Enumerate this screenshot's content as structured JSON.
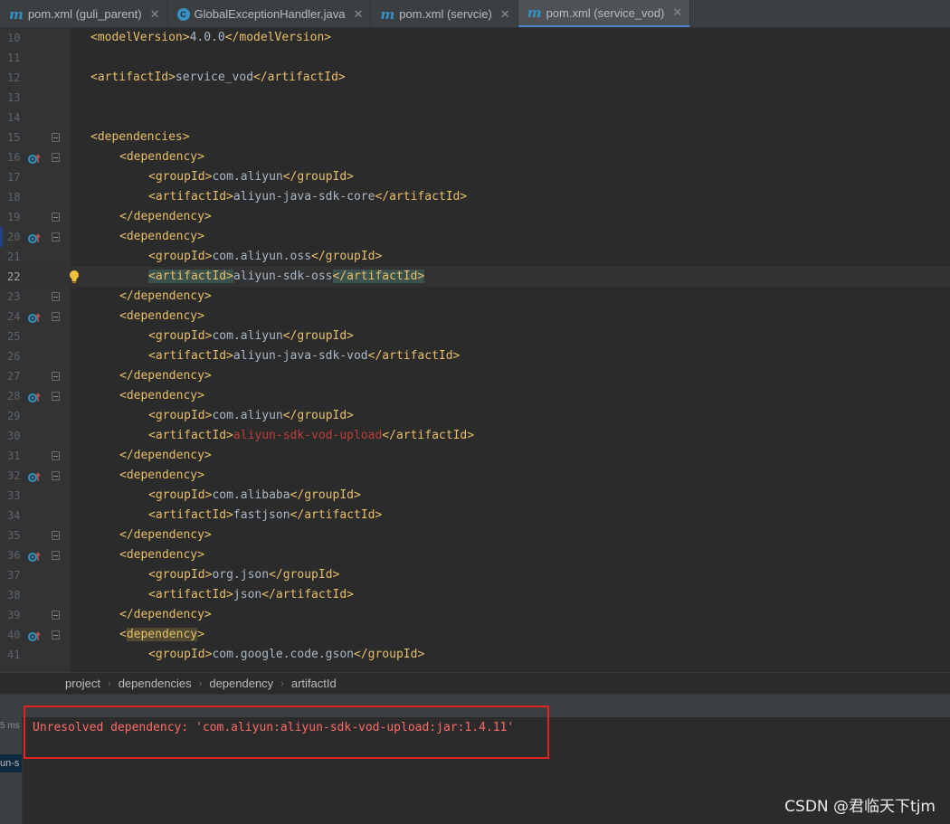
{
  "tabs": [
    {
      "label": "pom.xml (guli_parent)",
      "icon": "maven-icon",
      "active": false
    },
    {
      "label": "GlobalExceptionHandler.java",
      "icon": "java-class-icon",
      "active": false
    },
    {
      "label": "pom.xml (servcie)",
      "icon": "maven-icon",
      "active": false
    },
    {
      "label": "pom.xml (service_vod)",
      "icon": "maven-icon",
      "active": true
    }
  ],
  "editor": {
    "lines": [
      {
        "num": "10",
        "indent": 0,
        "tag": "modelVersion",
        "value": "4.0.0"
      },
      {
        "num": "11"
      },
      {
        "num": "12",
        "indent": 0,
        "tag": "artifactId",
        "value": "service_vod"
      },
      {
        "num": "13"
      },
      {
        "num": "14"
      },
      {
        "num": "15",
        "indent": 0,
        "open": "dependencies",
        "fold": true
      },
      {
        "num": "16",
        "indent": 1,
        "open": "dependency",
        "fold": true,
        "mvn": true
      },
      {
        "num": "17",
        "indent": 2,
        "tag": "groupId",
        "value": "com.aliyun"
      },
      {
        "num": "18",
        "indent": 2,
        "tag": "artifactId",
        "value": "aliyun-java-sdk-core"
      },
      {
        "num": "19",
        "indent": 1,
        "close": "dependency",
        "fold": true
      },
      {
        "num": "20",
        "indent": 1,
        "open": "dependency",
        "fold": true,
        "mvn": true,
        "marker": true
      },
      {
        "num": "21",
        "indent": 2,
        "tag": "groupId",
        "value": "com.aliyun.oss"
      },
      {
        "num": "22",
        "indent": 2,
        "tag": "artifactId",
        "value": "aliyun-sdk-oss",
        "current": true,
        "highlight": true,
        "bulb": true
      },
      {
        "num": "23",
        "indent": 1,
        "close": "dependency",
        "fold": true
      },
      {
        "num": "24",
        "indent": 1,
        "open": "dependency",
        "fold": true,
        "mvn": true
      },
      {
        "num": "25",
        "indent": 2,
        "tag": "groupId",
        "value": "com.aliyun"
      },
      {
        "num": "26",
        "indent": 2,
        "tag": "artifactId",
        "value": "aliyun-java-sdk-vod"
      },
      {
        "num": "27",
        "indent": 1,
        "close": "dependency",
        "fold": true
      },
      {
        "num": "28",
        "indent": 1,
        "open": "dependency",
        "fold": true,
        "mvn": true
      },
      {
        "num": "29",
        "indent": 2,
        "tag": "groupId",
        "value": "com.aliyun"
      },
      {
        "num": "30",
        "indent": 2,
        "tag": "artifactId",
        "value": "aliyun-sdk-vod-upload",
        "error": true
      },
      {
        "num": "31",
        "indent": 1,
        "close": "dependency",
        "fold": true
      },
      {
        "num": "32",
        "indent": 1,
        "open": "dependency",
        "fold": true,
        "mvn": true
      },
      {
        "num": "33",
        "indent": 2,
        "tag": "groupId",
        "value": "com.alibaba"
      },
      {
        "num": "34",
        "indent": 2,
        "tag": "artifactId",
        "value": "fastjson"
      },
      {
        "num": "35",
        "indent": 1,
        "close": "dependency",
        "fold": true
      },
      {
        "num": "36",
        "indent": 1,
        "open": "dependency",
        "fold": true,
        "mvn": true
      },
      {
        "num": "37",
        "indent": 2,
        "tag": "groupId",
        "value": "org.json"
      },
      {
        "num": "38",
        "indent": 2,
        "tag": "artifactId",
        "value": "json"
      },
      {
        "num": "39",
        "indent": 1,
        "close": "dependency",
        "fold": true
      },
      {
        "num": "40",
        "indent": 1,
        "open": "dependency",
        "fold": true,
        "mvn": true,
        "openHighlight": true
      },
      {
        "num": "41",
        "indent": 2,
        "tag": "groupId",
        "value": "com.google.code.gson"
      }
    ]
  },
  "breadcrumb": [
    "project",
    "dependencies",
    "dependency",
    "artifactId"
  ],
  "panel": {
    "time_fragment": "5 ms",
    "tree_fragment": "un-s",
    "error_message": "Unresolved dependency: 'com.aliyun:aliyun-sdk-vod-upload:jar:1.4.11'"
  },
  "watermark": "CSDN @君临天下tjm",
  "colors": {
    "tag": "#e8bf6a",
    "text": "#a9b7c6",
    "error_text": "#bc3f3c",
    "error_message": "#ff6b68",
    "annotation_box": "#e02424",
    "accent": "#4a88c7"
  }
}
